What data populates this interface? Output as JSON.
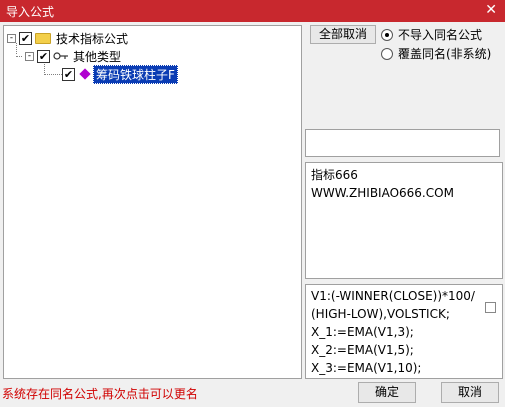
{
  "window": {
    "title": "导入公式",
    "close_glyph": "✕"
  },
  "tree": {
    "root": {
      "label": "技术指标公式",
      "expand": "-",
      "checked": "✔"
    },
    "group": {
      "label": "其他类型",
      "expand": "-",
      "checked": "✔"
    },
    "item": {
      "label": "筹码铁球柱子F",
      "checked": "✔"
    }
  },
  "options": {
    "deselect_all_label": "全部取消",
    "radio_skip_label": "不导入同名公式",
    "radio_overwrite_label": "覆盖同名(非系统)"
  },
  "description": {
    "line1": "指标666",
    "line2": "WWW.ZHIBIAO666.COM"
  },
  "code": {
    "lines": [
      "V1:(-WINNER(CLOSE))*100/",
      "(HIGH-LOW),VOLSTICK;",
      "X_1:=EMA(V1,3);",
      "X_2:=EMA(V1,5);",
      "X_3:=EMA(V1,10);"
    ]
  },
  "footer": {
    "status_text": "系统存在同名公式,再次点击可以更名",
    "ok_label": "确定",
    "cancel_label": "取消"
  },
  "colors": {
    "titlebar": "#c8282e",
    "selection": "#0a3cb4",
    "status_text": "#d00000"
  }
}
